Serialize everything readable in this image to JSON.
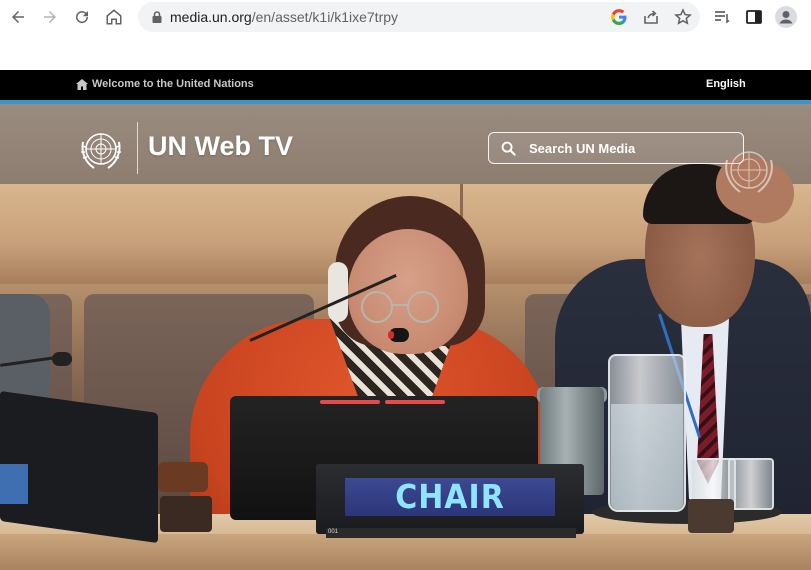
{
  "browser": {
    "url_domain": "media.un.org",
    "url_path": "/en/asset/k1i/k1ixe7trpy",
    "icons": [
      "back-icon",
      "forward-icon",
      "reload-icon",
      "home-icon",
      "lock-icon",
      "google-icon",
      "share-icon",
      "bookmark-star-icon",
      "reading-list-icon",
      "side-panel-icon",
      "profile-icon"
    ]
  },
  "un_topbar": {
    "welcome": "Welcome to the United Nations",
    "language": "English"
  },
  "header": {
    "title": "UN Web TV",
    "search_placeholder": "Search UN Media"
  },
  "video": {
    "nameplate_text": "CHAIR",
    "nameplate_number": "001"
  },
  "colors": {
    "topbar_bg": "#000000",
    "accent": "#3a95c9",
    "nameplate_text": "#8fe4ff"
  }
}
